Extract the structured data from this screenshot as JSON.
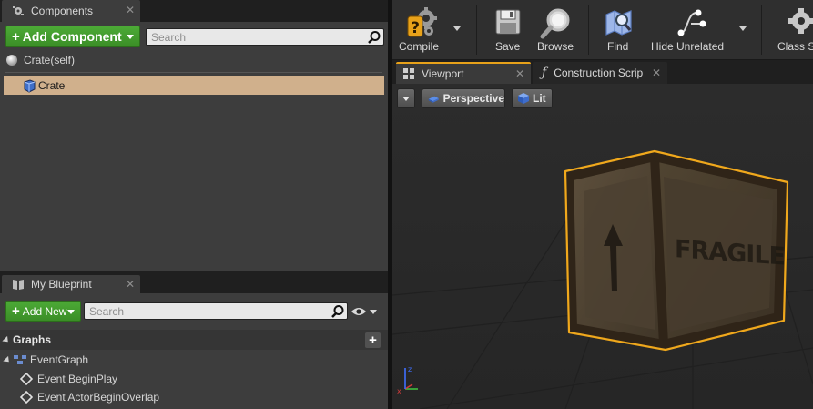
{
  "components_panel": {
    "tab_label": "Components",
    "add_component_label": "Add Component",
    "search_placeholder": "Search",
    "root_label": "Crate(self)",
    "items": [
      {
        "label": "Crate",
        "selected": true
      }
    ]
  },
  "my_blueprint_panel": {
    "tab_label": "My Blueprint",
    "add_new_label": "Add New",
    "search_placeholder": "Search",
    "section_label": "Graphs",
    "graph_label": "EventGraph",
    "events": [
      {
        "label": "Event BeginPlay"
      },
      {
        "label": "Event ActorBeginOverlap"
      }
    ]
  },
  "toolbar": {
    "compile_label": "Compile",
    "save_label": "Save",
    "browse_label": "Browse",
    "find_label": "Find",
    "hide_unrelated_label": "Hide Unrelated",
    "class_settings_label": "Class S"
  },
  "editor_tabs": [
    {
      "label": "Viewport",
      "active": true
    },
    {
      "label": "Construction Scrip",
      "active": false
    }
  ],
  "viewport": {
    "view_mode_label": "Perspective",
    "lighting_label": "Lit",
    "crate_text": "FRAGILE",
    "accent_selection": "#f0a81c"
  },
  "colors": {
    "add_button_green": "#4caa36",
    "selected_row": "#d0b08c"
  }
}
